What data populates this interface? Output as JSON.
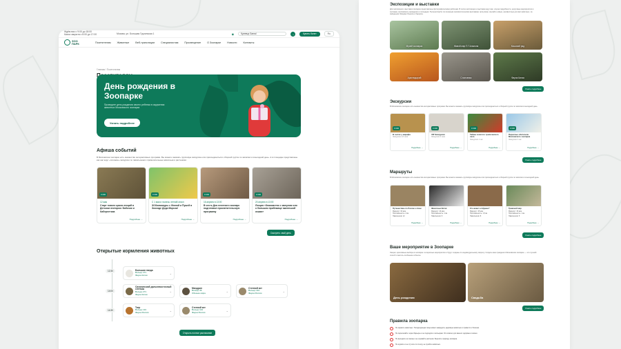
{
  "left": {
    "topbar": {
      "hours_line1": "Ждём вас с 9:00 до 18:00",
      "hours_line2": "Касса закрыта с 8:00 до 17:00",
      "address": "Москва, ул. Большая Грузинская 1",
      "search_value": "Кузнеца Gamal",
      "search_go": "→",
      "buy_label": "Купить билет",
      "lang": "Ru"
    },
    "logo": {
      "line1": "ЗОО",
      "line2": "ПАРК"
    },
    "nav": [
      "Посетителям",
      "Животные",
      "Веб-трансляции",
      "Специалистам",
      "Просвещение",
      "О Зоопарке",
      "Новости",
      "Контакты"
    ],
    "breadcrumbs": "Главная / Посетителям",
    "page_title": "Посетителям",
    "hero": {
      "title": "День рождения в Зоопарке",
      "text": "Проведите день рождения своего ребенка в окружении животных Московского зоопарка",
      "button": "Узнать подробнее"
    },
    "events": {
      "title": "Афиша событий",
      "desc": "В Московском зоопарке есть множество интерактивных программ. Вы можете заказать групповую экскурсию или присоединиться к сборной группе по записям и в выходной день. А в площадке представлены как нас ждут «похожие» экскурсии по павильонам и примечательные животным и растениям.",
      "cards": [
        {
          "badge": "0 000",
          "date": "12 мая",
          "title": "Старт нового цикла лекций в Детском лектории: Бабочки и Кибернетика",
          "more": "Подробнее →"
        },
        {
          "badge": "0 000",
          "date": "С 1 мая и на весь летний сезон",
          "title": "ЗООкомикуры с Жюной и Пушей в Зоосаде Деда Мороза!",
          "more": "Подробнее →"
        },
        {
          "badge": "0 000",
          "date": "16 апреля в 13:00",
          "title": "В честь Дня нелегкого зоопарк подготовил просветительскую программу",
          "more": "Подробнее →"
        },
        {
          "badge": "0 000",
          "date": "20 апреля в 13:00",
          "title": "Лекция «Знакомство с манулом или о большом прибежище маленькой кошки»",
          "more": "Подробнее →"
        }
      ],
      "all_button": "Смотреть свой день"
    },
    "feeding": {
      "title": "Открытые кормления животных",
      "times": [
        "12:30",
        "14:00",
        "14:30"
      ],
      "items": [
        {
          "name": "Большая панда",
          "sub1": "Вольер 471",
          "sub2": "Фауна Китая"
        },
        {
          "name": "Сахалинский дальневосточный слепыш",
          "sub1": "Вольер 271",
          "sub2": "Фауна Китая"
        },
        {
          "name": "Мандрил",
          "sub1": "Вольер 36",
          "sub2": "Обезьян мира"
        },
        {
          "name": "Степной кот",
          "sub1": "Вольер 144",
          "sub2": "Фауна России"
        },
        {
          "name": "Тигр",
          "sub1": "Вольер 131",
          "sub2": "Фауна России"
        },
        {
          "name": "Степной кот",
          "sub1": "Вольер 144",
          "sub2": "Фауна России"
        }
      ],
      "all_button": "Открыть полное расписание"
    }
  },
  "right": {
    "exhibits": {
      "title": "Экспозиции и выставки",
      "desc": "Для экспозиции и выставок зоопарка представлены фотографическими работами. В холле экспозиции и выставки ждут вас, изучая подробности, досуговые мероприятия в зоопарке, московские учреждения и площадки. Путешествуйте по сезонным просветительским выставкам, прогулкам, изучайте новые, неизвестные для вас животных, за звёздными Ловцами Льюиса и Харриса.",
      "items": [
        "Музей зоопарка",
        "Живой мир П.Т.Алкиона",
        "Кошачий ряд",
        "Арахнидарий",
        "Слоновник",
        "Фауна Китая"
      ],
      "all_button": "Узнать подробнее"
    },
    "excursions": {
      "title": "Экскурсии",
      "desc": "В Московском зоопарке есть множество интерактивных программ. Вы можете заказать групповую экскурсию или присоединиться к сборной группе по записям в выходной день.",
      "cards": [
        {
          "badge": "0 000",
          "title": "В гостях у жирафа",
          "sub": "Экскурсия 1,5 часа",
          "more": "Подробнее →"
        },
        {
          "badge": "0 000",
          "title": "VIP Экскурсия",
          "sub": "Экскурсия 2 часа",
          "more": "Подробнее →"
        },
        {
          "badge": "0 000",
          "title": "Тайны золотого тропического леса",
          "sub": "Экскурсия 1 час",
          "more": "Подробнее →"
        },
        {
          "badge": "0 000",
          "title": "Пернатые обитатели Московского зоопарка",
          "sub": "Экскурсия 1 час",
          "more": "Подробнее →"
        }
      ],
      "all_button": "Узнать подробнее"
    },
    "routes": {
      "title": "Маршруты",
      "desc": "В Московском зоопарке есть множество интерактивных программ. Вы можете заказать групповую экскурсию или присоединиться к сборной группе по записям и в выходной день.",
      "cards": [
        {
          "title": "Путешествие по России и Азии",
          "rows": [
            "Маршрут: 60 мин",
            "Протяжённость: 2 км",
            "Павильонов: 12"
          ],
          "more": "Подробнее →"
        },
        {
          "title": "Животные Китая",
          "rows": [
            "Маршрут: 40 мин",
            "Протяжённость: 1 км",
            "Павильонов: 6"
          ],
          "more": "Подробнее →"
        },
        {
          "title": "Кто живет в Африке?",
          "rows": [
            "Маршрут: 45 мин",
            "Протяжённость: 1,5 км",
            "Павильонов: 8"
          ],
          "more": "Подробнее →"
        },
        {
          "title": "Травяной мир",
          "rows": [
            "Маршрут: 30 мин",
            "Протяжённость: 1 км",
            "Павильонов: 5"
          ],
          "more": "Подробнее →"
        }
      ],
      "all_button": "Узнать подробнее"
    },
    "your_event": {
      "title": "Ваше мероприятие в Зоопарке",
      "desc": "Лекции, креативные выборы в зоопарке: интересные мероприятия и будут созданы по индивидуальному запросу. Создать ваш праздник в Московском зоопарке — это лучший способ отметить особенное событие.",
      "cards": [
        "День рождения",
        "Свадьба"
      ],
      "all_button": "Узнать подробнее"
    },
    "rules": {
      "title": "Правила зоопарка",
      "items": [
        "Не кормите животных. Неподходящая пища может навредить здоровью животных и привести к болезни.",
        "Не перелезайте через барьеры и не подходите к вольерам. Это опасно для вашего здоровья и жизни.",
        "Не выходите на газоны и не срывайте растения. Берегите природу зоопарка.",
        "Не шумите и не стучите по стеклу, не пугайте животных."
      ]
    }
  }
}
